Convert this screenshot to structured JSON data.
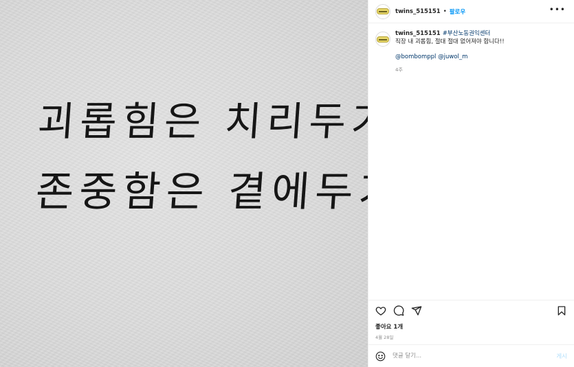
{
  "photo": {
    "line1": "괴롭힘은 치리두기",
    "line2": "존중함은 곁에두기"
  },
  "header": {
    "username": "twins_515151",
    "separator": "•",
    "follow_label": "팔로우",
    "more_label": "•••"
  },
  "caption": {
    "username": "twins_515151",
    "hashtag": "#부산노동권익센터",
    "text": "직장 내 괴롭힘, 절대 절대 없어져야 합니다!!",
    "mentions": [
      "@bombomppl",
      "@juwol_m"
    ],
    "age": "4주"
  },
  "actions": {
    "icons": [
      "heart-icon",
      "comment-icon",
      "share-icon",
      "bookmark-icon"
    ]
  },
  "likes": "좋아요 1개",
  "date": "4월 28일",
  "comment": {
    "placeholder": "댓글 달기...",
    "post_label": "게시"
  },
  "colors": {
    "link": "#00376b",
    "follow": "#0095f6",
    "post_disabled": "#b2dffc",
    "muted": "#8e8e8e"
  }
}
